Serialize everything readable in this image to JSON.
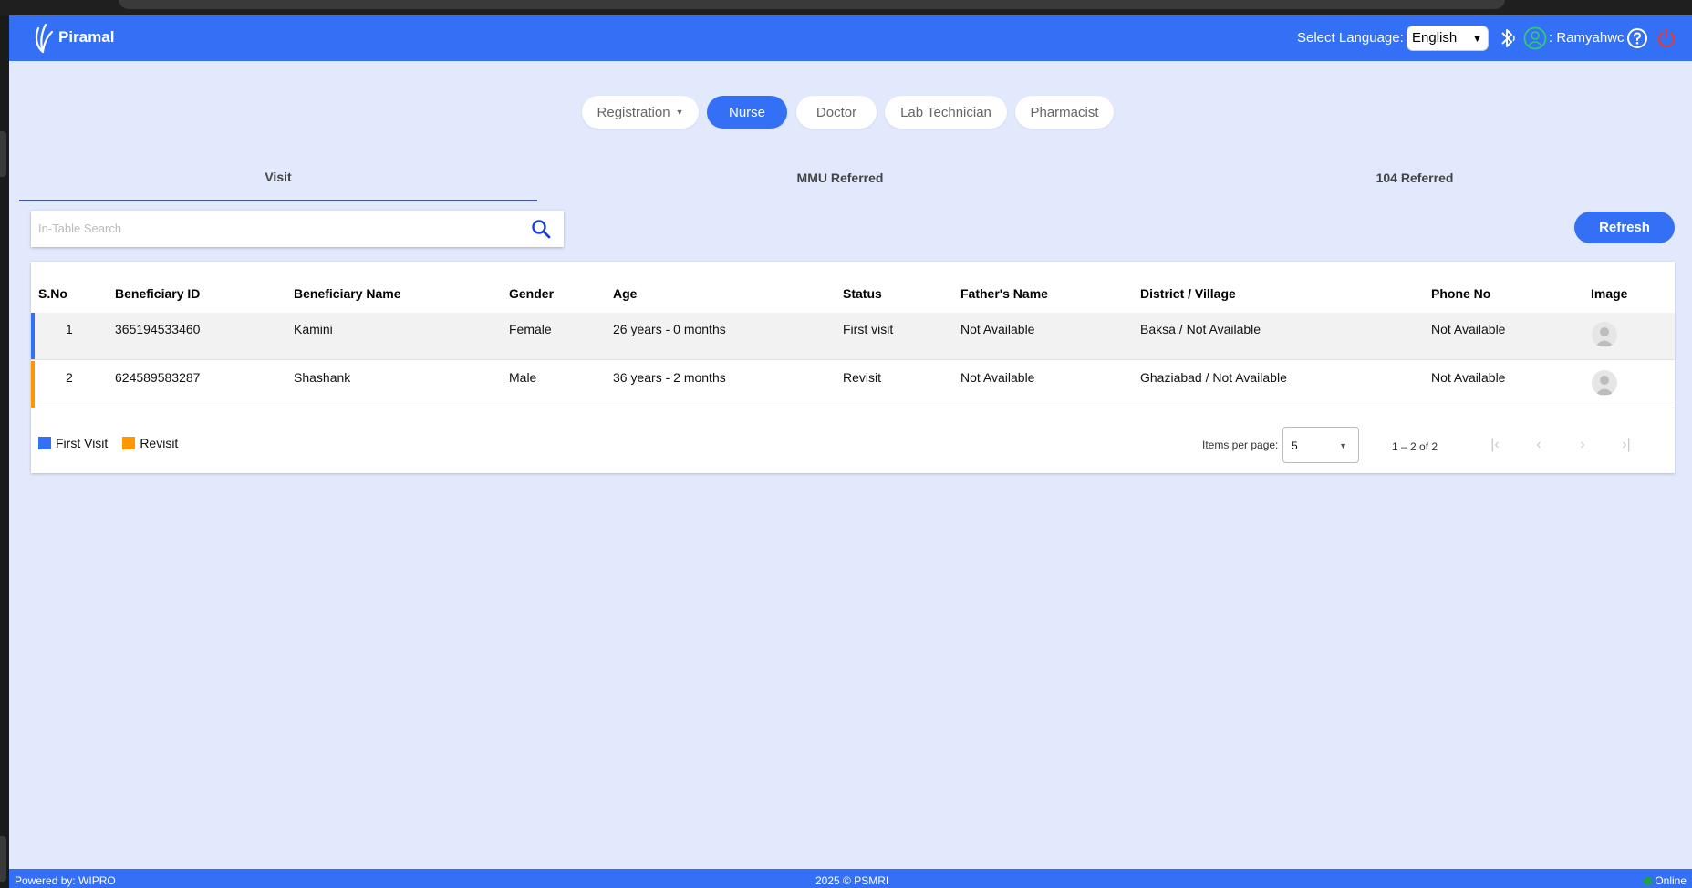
{
  "header": {
    "brand": "Piramal",
    "language_label": "Select Language:",
    "language_value": "English",
    "user_name": ": Ramyahwc",
    "icons": [
      "bluetooth-icon",
      "user-circle-icon",
      "help-icon",
      "power-icon"
    ],
    "colors": {
      "primary": "#3470f5",
      "power": "#e53935",
      "user": "#2ecc71"
    }
  },
  "role_tabs": [
    {
      "label": "Registration",
      "active": false,
      "dropdown": true
    },
    {
      "label": "Nurse",
      "active": true,
      "dropdown": false
    },
    {
      "label": "Doctor",
      "active": false,
      "dropdown": false
    },
    {
      "label": "Lab Technician",
      "active": false,
      "dropdown": false
    },
    {
      "label": "Pharmacist",
      "active": false,
      "dropdown": false
    }
  ],
  "sub_tabs": [
    {
      "label": "Visit",
      "active": true
    },
    {
      "label": "MMU Referred",
      "active": false
    },
    {
      "label": "104 Referred",
      "active": false
    }
  ],
  "search": {
    "placeholder": "In-Table Search",
    "value": ""
  },
  "refresh_label": "Refresh",
  "table": {
    "columns": [
      "S.No",
      "Beneficiary ID",
      "Beneficiary Name",
      "Gender",
      "Age",
      "Status",
      "Father's Name",
      "District / Village",
      "Phone No",
      "Image"
    ],
    "rows": [
      {
        "sno": "1",
        "id": "365194533460",
        "name": "Kamini",
        "gender": "Female",
        "age": "26 years - 0 months",
        "status": "First visit",
        "father": "Not Available",
        "district": "Baksa / Not Available",
        "phone": "Not Available",
        "visit_type": "first"
      },
      {
        "sno": "2",
        "id": "624589583287",
        "name": "Shashank",
        "gender": "Male",
        "age": "36 years - 2 months",
        "status": "Revisit",
        "father": "Not Available",
        "district": "Ghaziabad / Not Available",
        "phone": "Not Available",
        "visit_type": "revisit"
      }
    ]
  },
  "legend": [
    {
      "label": "First Visit",
      "color": "#3470f5"
    },
    {
      "label": "Revisit",
      "color": "#ff9800"
    }
  ],
  "pagination": {
    "items_per_page_label": "Items per page:",
    "items_per_page": "5",
    "range": "1 – 2 of 2"
  },
  "footer": {
    "powered_by": "Powered by: WIPRO",
    "copyright": "2025 © PSMRI",
    "status": "Online"
  }
}
